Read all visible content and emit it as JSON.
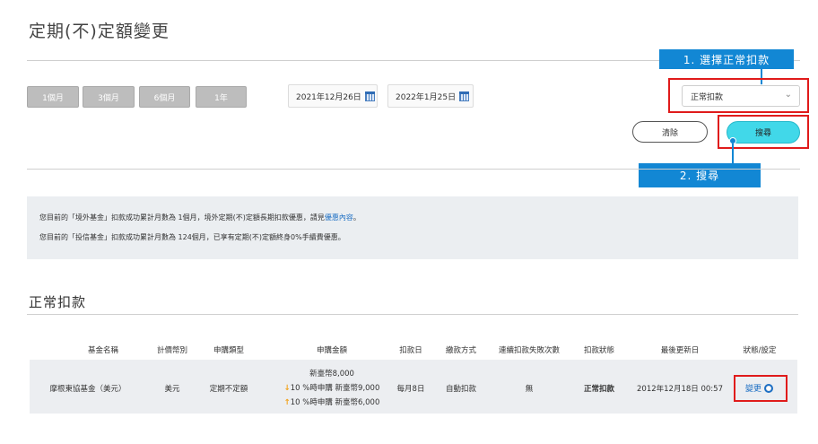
{
  "page": {
    "title": "定期(不)定額變更"
  },
  "filters": {
    "periods": [
      "1個月",
      "3個月",
      "6個月",
      "1年"
    ],
    "start_date": "2021年12月26日",
    "end_date": "2022年1月25日",
    "status_select": {
      "selected": "正常扣款"
    },
    "clear_label": "清除",
    "search_label": "搜尋"
  },
  "callouts": {
    "step1": "1. 選擇正常扣款",
    "step2": "2. 搜尋"
  },
  "info": {
    "line1_prefix": "您目前的「境外基金」扣款成功累計月數為 1個月，境外定期(不)定額長期扣款優惠，請見",
    "line1_link": "優惠內容",
    "line1_suffix": "。",
    "line2": "您目前的「投信基金」扣款成功累計月數為 124個月，已享有定期(不)定額終身0%手續費優惠。"
  },
  "section": {
    "title": "正常扣款"
  },
  "table": {
    "headers": [
      "基金名稱",
      "計價幣別",
      "申購類型",
      "申購金額",
      "扣款日",
      "繳款方式",
      "連續扣款失敗次數",
      "扣款狀態",
      "最後更新日",
      "狀態/設定"
    ],
    "row": {
      "fund": "摩根東協基金（美元）",
      "currency": "美元",
      "type": "定期不定額",
      "amount_main": "新臺幣8,000",
      "amount_down": "10 %時申購 新臺幣9,000",
      "amount_up": "10 %時申購 新臺幣6,000",
      "debit_day": "每月8日",
      "payment": "自動扣款",
      "fail_count": "無",
      "status": "正常扣款",
      "updated": "2012年12月18日 00:57",
      "action": "變更"
    }
  },
  "colors": {
    "accent": "#1287d4",
    "highlight": "#e01b1b",
    "search_button": "#41d8e9"
  }
}
